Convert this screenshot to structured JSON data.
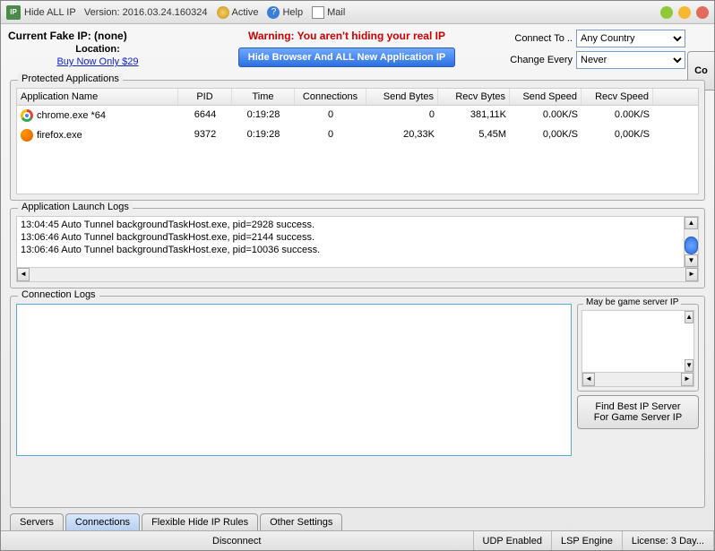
{
  "titlebar": {
    "app_name": "Hide ALL IP",
    "version_label": "Version:",
    "version": "2016.03.24.160324",
    "active": "Active",
    "help": "Help",
    "mail": "Mail"
  },
  "header": {
    "current_fake_ip_label": "Current Fake IP:",
    "current_fake_ip_value": "(none)",
    "location_label": "Location:",
    "buy_link": "Buy Now Only $29",
    "warning": "Warning: You aren't hiding your real IP",
    "hide_button": "Hide Browser And ALL New Application IP",
    "connect_to_label": "Connect To ..",
    "connect_to_value": "Any Country",
    "change_every_label": "Change Every",
    "change_every_value": "Never",
    "corner_button": "Co"
  },
  "protected": {
    "legend": "Protected Applications",
    "columns": {
      "name": "Application Name",
      "pid": "PID",
      "time": "Time",
      "connections": "Connections",
      "send": "Send Bytes",
      "recv": "Recv Bytes",
      "ss": "Send Speed",
      "rs": "Recv Speed"
    },
    "rows": [
      {
        "icon": "chrome",
        "name": "chrome.exe *64",
        "pid": "6644",
        "time": "0:19:28",
        "conn": "0",
        "send": "0",
        "recv": "381,11K",
        "ss": "0.00K/S",
        "rs": "0.00K/S"
      },
      {
        "icon": "firefox",
        "name": "firefox.exe",
        "pid": "9372",
        "time": "0:19:28",
        "conn": "0",
        "send": "20,33K",
        "recv": "5,45M",
        "ss": "0,00K/S",
        "rs": "0,00K/S"
      }
    ]
  },
  "launch_logs": {
    "legend": "Application Launch Logs",
    "lines": [
      "13:04:45 Auto Tunnel backgroundTaskHost.exe, pid=2928 success.",
      "13:06:46 Auto Tunnel backgroundTaskHost.exe, pid=2144 success.",
      "13:06:46 Auto Tunnel backgroundTaskHost.exe, pid=10036 success."
    ]
  },
  "conn_logs": {
    "legend": "Connection Logs",
    "game_legend": "May be game server IP",
    "find_button_l1": "Find Best IP Server",
    "find_button_l2": "For Game Server IP"
  },
  "tabs": {
    "servers": "Servers",
    "connections": "Connections",
    "flexible": "Flexible Hide IP Rules",
    "other": "Other Settings"
  },
  "statusbar": {
    "disconnect": "Disconnect",
    "udp": "UDP Enabled",
    "lsp": "LSP Engine",
    "license": "License: 3 Day..."
  }
}
